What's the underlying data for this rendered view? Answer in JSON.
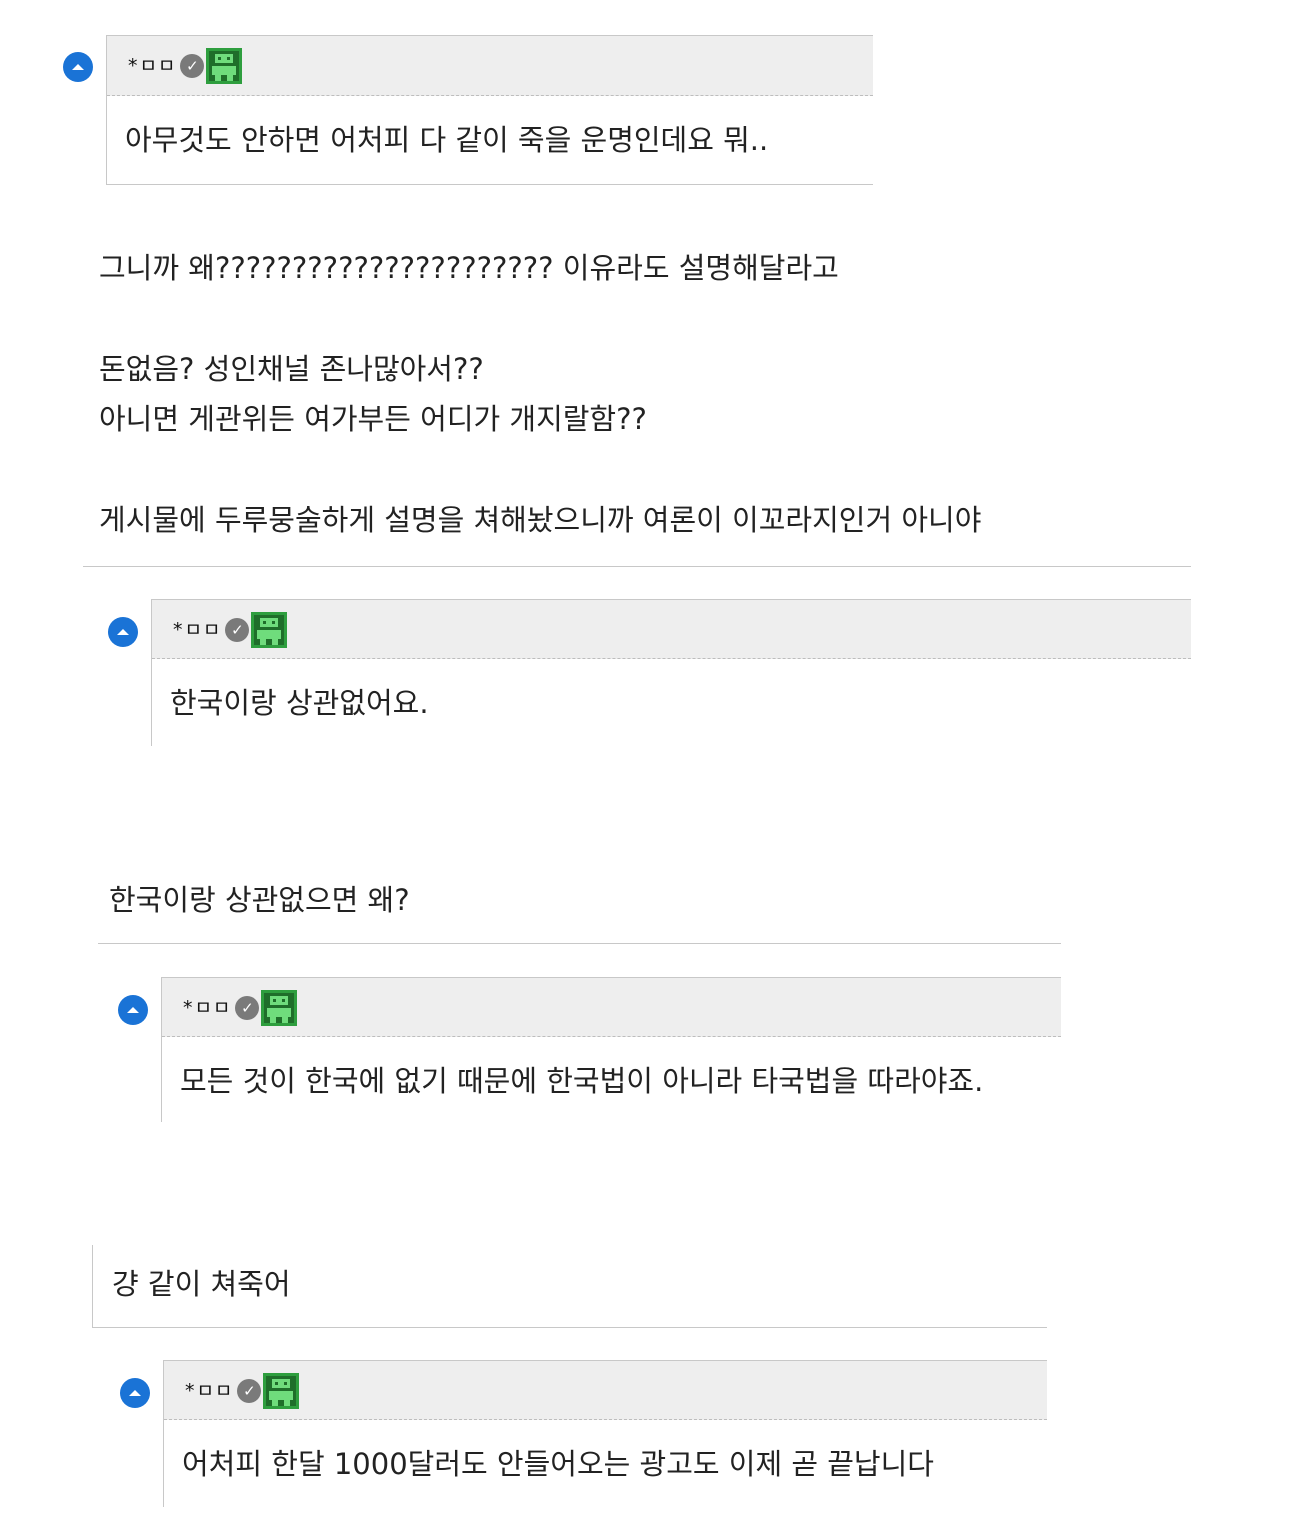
{
  "replies": [
    {
      "author": "*ㅁㅁ",
      "verified_icon": "check-circle-icon",
      "level_icon": "green-robot-level-icon",
      "text": "아무것도 안하면 어처피 다 같이 죽을 운명인데요 뭐.."
    },
    {
      "author": "*ㅁㅁ",
      "verified_icon": "check-circle-icon",
      "level_icon": "green-robot-level-icon",
      "text": "한국이랑 상관없어요."
    },
    {
      "author": "*ㅁㅁ",
      "verified_icon": "check-circle-icon",
      "level_icon": "green-robot-level-icon",
      "text": "모든 것이 한국에 없기 때문에 한국법이 아니라 타국법을 따라야죠."
    },
    {
      "author": "*ㅁㅁ",
      "verified_icon": "check-circle-icon",
      "level_icon": "green-robot-level-icon",
      "text": "어처피 한달 1000달러도 안들어오는 광고도 이제 곧 끝납니다"
    }
  ],
  "comments": [
    {
      "lines": [
        "그니까 왜?????????????????????? 이유라도 설명해달라고",
        "돈없음? 성인채널 존나많아서??",
        "아니면 게관위든 여가부든 어디가 개지랄함??",
        "게시물에 두루뭉술하게 설명을 쳐해놨으니까 여론이 이꼬라지인거 아니야"
      ]
    },
    {
      "lines": [
        "한국이랑 상관없으면 왜?"
      ]
    },
    {
      "lines": [
        "걍 같이 쳐죽어"
      ]
    }
  ],
  "colors": {
    "accent_blue": "#1a73d6",
    "highlight_yellow": "#f2e24a",
    "header_gray": "#eeeeee",
    "level_green": "#2e9e3e"
  }
}
